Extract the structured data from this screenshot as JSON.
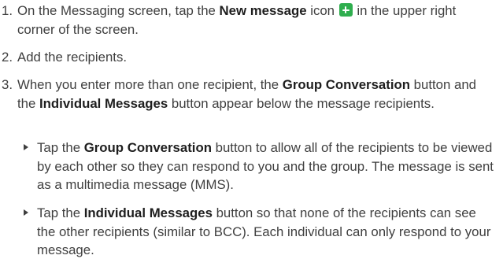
{
  "steps": [
    {
      "number": "1.",
      "text_before": "On the Messaging screen, tap the ",
      "bold": "New message",
      "text_middle": " icon ",
      "icon": "new-message-plus-icon",
      "text_after": " in the upper right corner of the screen."
    },
    {
      "number": "2.",
      "text": "Add the recipients."
    },
    {
      "number": "3.",
      "text_before": "When you enter more than one recipient, the ",
      "bold1": "Group Conversation",
      "text_middle": " button and the ",
      "bold2": "Individual Messages",
      "text_after": " button appear below the message recipients."
    }
  ],
  "bullets": [
    {
      "text_before": "Tap the ",
      "bold": "Group Conversation",
      "text_after": " button to allow all of the recipients to be viewed by each other so they can respond to you and the group. The message is sent as a multimedia message (MMS)."
    },
    {
      "text_before": "Tap the ",
      "bold": "Individual Messages",
      "text_after": " button so that none of the recipients can see the other recipients (similar to BCC). Each individual can only respond to your message."
    }
  ],
  "colors": {
    "text": "#3f3f3f",
    "bold_text": "#1e1e1e",
    "icon_green": "#2fae4e"
  }
}
